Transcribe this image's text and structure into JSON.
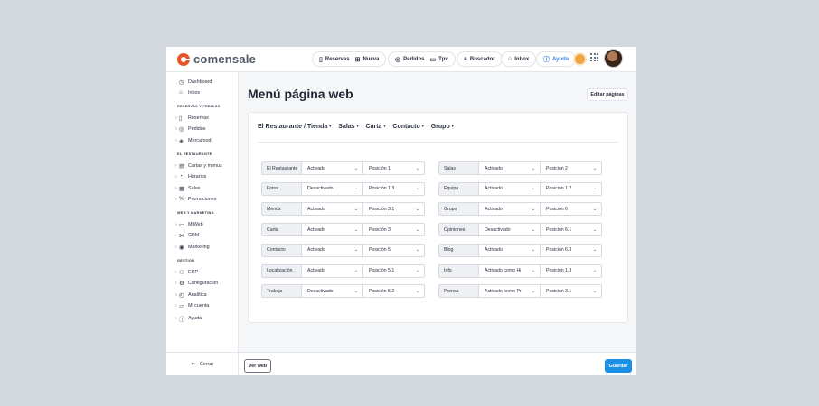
{
  "brand": {
    "name": "comensale",
    "color": "#e8542a"
  },
  "topnav": {
    "group1": [
      {
        "icon": "book-icon",
        "glyph": "▯",
        "label": "Reservas"
      },
      {
        "icon": "plus-square-icon",
        "glyph": "⊞",
        "label": "Nueva"
      }
    ],
    "group2": [
      {
        "icon": "plate-icon",
        "glyph": "◎",
        "label": "Pedidos"
      },
      {
        "icon": "card-icon",
        "glyph": "▭",
        "label": "Tpv"
      }
    ],
    "search": {
      "icon": "search-icon",
      "glyph": "⌕",
      "label": "Buscador"
    },
    "inbox": {
      "icon": "inbox-icon",
      "glyph": "⌂",
      "label": "Inbox"
    },
    "help": {
      "icon": "help-icon",
      "glyph": "ⓘ",
      "label": "Ayuda",
      "color": "#3f7fd9"
    }
  },
  "sidebar": {
    "top": [
      {
        "icon": "dashboard-icon",
        "glyph": "◷",
        "label": "Dashboard"
      },
      {
        "icon": "inbox-icon",
        "glyph": "⌂",
        "label": "Inbox"
      }
    ],
    "sections": [
      {
        "title": "RESERVAS Y PEDIDOS",
        "items": [
          {
            "icon": "book-icon",
            "glyph": "▯",
            "label": "Reservas"
          },
          {
            "icon": "plate-icon",
            "glyph": "◎",
            "label": "Pedidos"
          },
          {
            "icon": "box-icon",
            "glyph": "◈",
            "label": "Mercafood"
          }
        ]
      },
      {
        "title": "EL RESTAURANTE",
        "items": [
          {
            "icon": "menu-book-icon",
            "glyph": "▤",
            "label": "Cartas y menus"
          },
          {
            "icon": "clock-icon",
            "glyph": "◔",
            "label": "Horarios"
          },
          {
            "icon": "grid-icon",
            "glyph": "▦",
            "label": "Salas"
          },
          {
            "icon": "percent-icon",
            "glyph": "%",
            "label": "Promociones"
          }
        ]
      },
      {
        "title": "WEB Y MARKETING",
        "items": [
          {
            "icon": "monitor-icon",
            "glyph": "▭",
            "label": "MiWeb"
          },
          {
            "icon": "share-icon",
            "glyph": "⋈",
            "label": "CRM"
          },
          {
            "icon": "broadcast-icon",
            "glyph": "◉",
            "label": "Marketing"
          }
        ]
      },
      {
        "title": "GESTION",
        "items": [
          {
            "icon": "users-icon",
            "glyph": "⚇",
            "label": "ERP"
          },
          {
            "icon": "gear-icon",
            "glyph": "⚙",
            "label": "Configuración"
          },
          {
            "icon": "chart-icon",
            "glyph": "◴",
            "label": "Analítica"
          },
          {
            "icon": "folder-icon",
            "glyph": "▱",
            "label": "Mi cuenta"
          },
          {
            "icon": "help-icon",
            "glyph": "ⓘ",
            "label": "Ayuda"
          }
        ]
      }
    ],
    "logout": {
      "icon": "logout-icon",
      "glyph": "⇤",
      "label": "Cerrar"
    }
  },
  "main": {
    "title": "Menú página web",
    "edit_button": "Editar páginas",
    "tabs": [
      "El Restaurante / Tienda",
      "Salas",
      "Carta",
      "Contacto",
      "Grupo"
    ],
    "left_rows": [
      {
        "label": "El Restaurante",
        "status": "Activado",
        "position": "Posición 1"
      },
      {
        "label": "Fotos",
        "status": "Desactivado",
        "position": "Posición 1.3"
      },
      {
        "label": "Menús",
        "status": "Activado",
        "position": "Posición 3.1"
      },
      {
        "label": "Carta",
        "status": "Activado",
        "position": "Posición 3"
      },
      {
        "label": "Contacto",
        "status": "Activado",
        "position": "Posición 5"
      },
      {
        "label": "Localización",
        "status": "Activado",
        "position": "Posición 5.1"
      },
      {
        "label": "Trabaja",
        "status": "Desactivado",
        "position": "Posición 5.2"
      }
    ],
    "right_rows": [
      {
        "label": "Salas",
        "status": "Activado",
        "position": "Posición 2"
      },
      {
        "label": "Equipo",
        "status": "Activado",
        "position": "Posición 1.2"
      },
      {
        "label": "Grupo",
        "status": "Activado",
        "position": "Posición 6"
      },
      {
        "label": "Opiniones",
        "status": "Desactivado",
        "position": "Posición 6.1"
      },
      {
        "label": "Blog",
        "status": "Activado",
        "position": "Posición 6.3"
      },
      {
        "label": "Info",
        "status": "Activado como Hi",
        "position": "Posición 1.3"
      },
      {
        "label": "Prensa",
        "status": "Activado como Pr",
        "position": "Posición 3.1"
      }
    ],
    "footer": {
      "view_web": "Ver web",
      "save": "Guardar",
      "save_color": "#1a8fe3"
    }
  }
}
